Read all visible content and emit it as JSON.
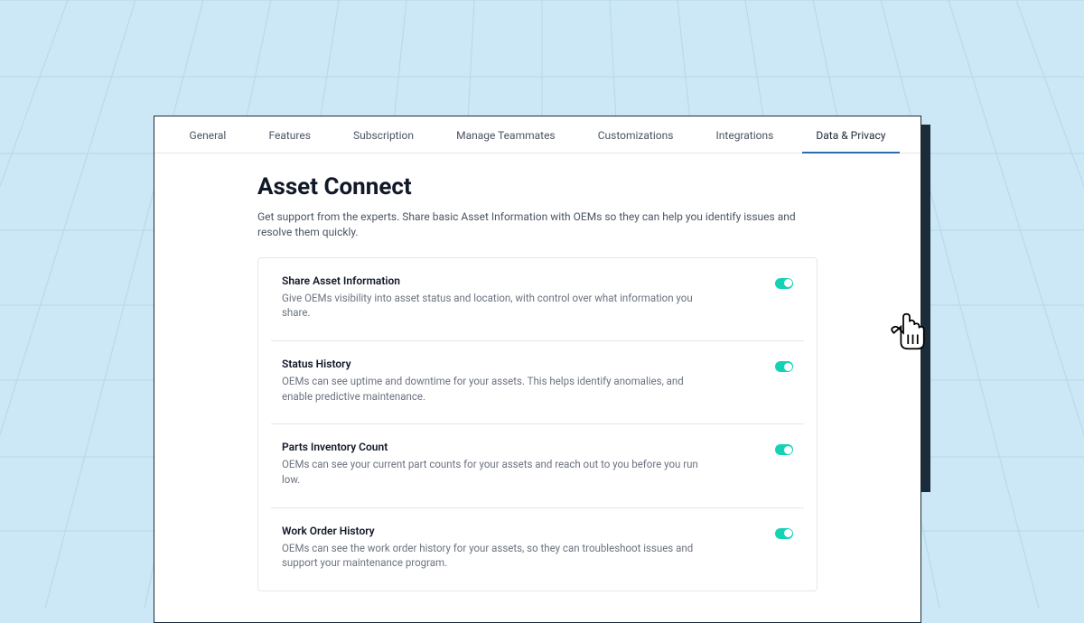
{
  "tabs": {
    "general": "General",
    "features": "Features",
    "subscription": "Subscription",
    "manage_teammates": "Manage Teammates",
    "customizations": "Customizations",
    "integrations": "Integrations",
    "data_privacy": "Data & Privacy"
  },
  "page": {
    "title": "Asset Connect",
    "subtitle": "Get support from the experts. Share basic Asset Information with OEMs so they can help you identify issues and resolve them quickly."
  },
  "settings": {
    "share": {
      "title": "Share Asset Information",
      "desc": "Give OEMs visibility into asset status and location, with control over what information you share."
    },
    "status_history": {
      "title": "Status History",
      "desc": "OEMs can see uptime and downtime for your assets. This helps identify anomalies, and enable predictive maintenance."
    },
    "parts_inventory": {
      "title": "Parts Inventory Count",
      "desc": "OEMs can see your current part counts for your assets and reach out to you before you run low."
    },
    "work_order": {
      "title": "Work Order History",
      "desc": "OEMs can see the work order history for your assets, so they can troubleshoot issues and support your maintenance program."
    }
  }
}
